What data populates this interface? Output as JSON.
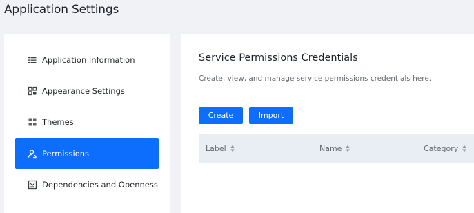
{
  "page": {
    "title": "Application Settings"
  },
  "sidebar": {
    "items": [
      {
        "label": "Application Information",
        "icon": "list-icon",
        "active": false
      },
      {
        "label": "Appearance Settings",
        "icon": "grid-layout-icon",
        "active": false
      },
      {
        "label": "Themes",
        "icon": "tiles-icon",
        "active": false
      },
      {
        "label": "Permissions",
        "icon": "user-permission-icon",
        "active": true
      },
      {
        "label": "Dependencies and Openness",
        "icon": "dependency-icon",
        "active": false
      }
    ]
  },
  "main": {
    "title": "Service Permissions Credentials",
    "description": "Create, view, and manage service permissions credentials here.",
    "buttons": {
      "create": "Create",
      "import": "Import"
    },
    "table": {
      "columns": [
        {
          "label": "Label",
          "sortable": true
        },
        {
          "label": "Name",
          "sortable": true
        },
        {
          "label": "Category",
          "sortable": true
        }
      ],
      "rows": []
    }
  },
  "colors": {
    "accent": "#0d6efd",
    "background": "#f0f2f5",
    "table_header": "#e9eef5"
  }
}
